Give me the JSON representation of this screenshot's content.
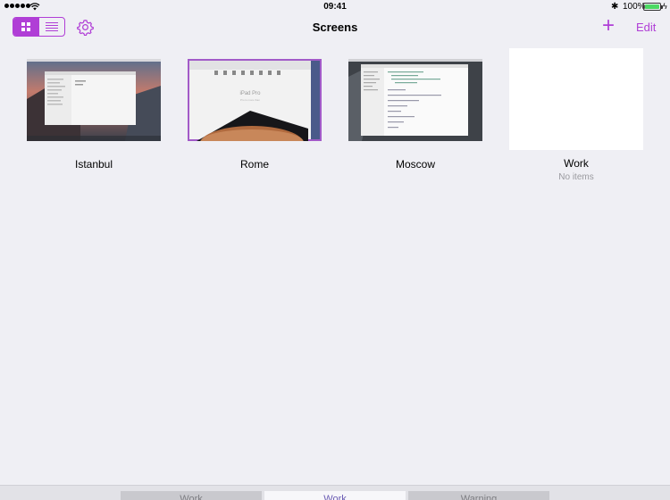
{
  "status": {
    "time": "09:41",
    "battery": "100%",
    "bluetooth_symbol": "✱"
  },
  "nav": {
    "title": "Screens",
    "edit_label": "Edit",
    "add_symbol": "+",
    "accent": "#b03ed6"
  },
  "screens": [
    {
      "name": "Istanbul",
      "subtitle": ""
    },
    {
      "name": "Rome",
      "subtitle": ""
    },
    {
      "name": "Moscow",
      "subtitle": ""
    },
    {
      "name": "Work",
      "subtitle": "No items"
    }
  ],
  "tabs": [
    "Work",
    "Work",
    "Warning"
  ]
}
